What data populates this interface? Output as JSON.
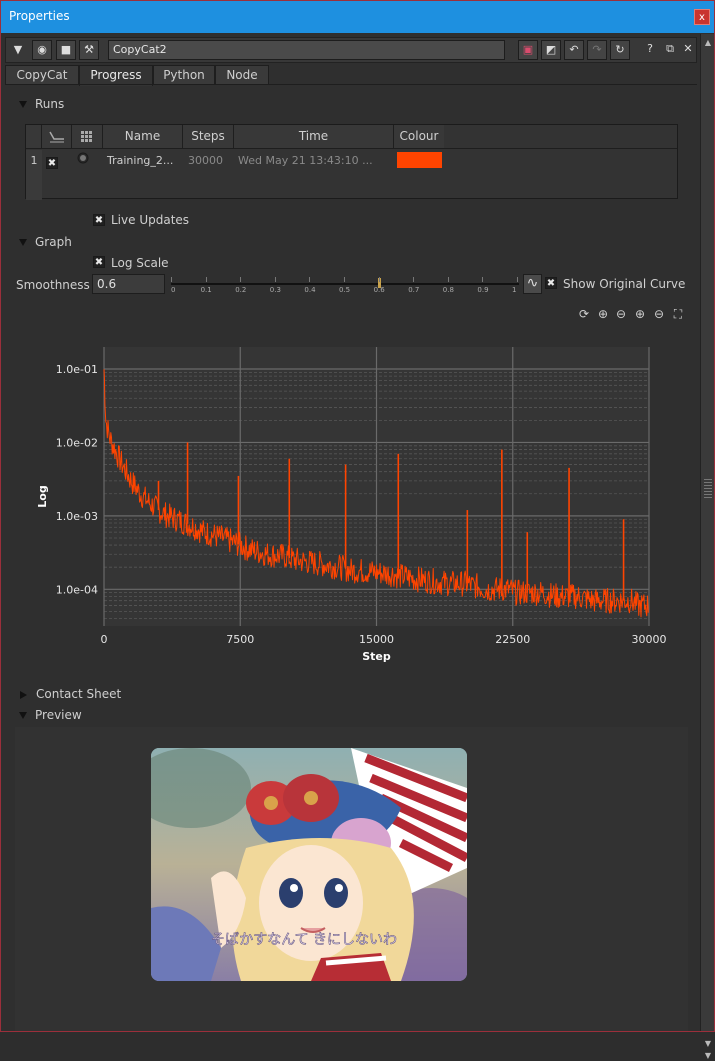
{
  "window": {
    "title": "Properties",
    "close_glyph": "x"
  },
  "toolbar": {
    "node_name": "CopyCat2",
    "icons": [
      "collapse-icon",
      "node-icon",
      "camera-icon",
      "wrench-icon",
      "color-swatch-icon",
      "matte-icon",
      "undo-icon",
      "redo-icon",
      "revert-icon",
      "help-icon",
      "float-icon",
      "close-icon"
    ],
    "help_glyph": "?",
    "float_glyph": "⧉",
    "close_glyph": "✕"
  },
  "tabs": [
    {
      "label": "CopyCat"
    },
    {
      "label": "Progress"
    },
    {
      "label": "Python"
    },
    {
      "label": "Node"
    }
  ],
  "runs": {
    "header": "Runs",
    "columns": [
      "Name",
      "Steps",
      "Time",
      "Colour"
    ],
    "rows": [
      {
        "index": "1",
        "visible": "✖",
        "name": "Training_2...",
        "steps": "30000",
        "time": "Wed May 21 13:43:10 ...",
        "colour": "#ff4400"
      }
    ]
  },
  "live_updates": {
    "label": "Live Updates",
    "checked": "✖"
  },
  "graph": {
    "header": "Graph",
    "log_scale": {
      "label": "Log Scale",
      "checked": "✖"
    },
    "smoothness": {
      "label": "Smoothness",
      "value": "0.6",
      "fraction": 0.6,
      "ticks": [
        "0",
        "0.1",
        "0.2",
        "0.3",
        "0.4",
        "0.5",
        "0.6",
        "0.7",
        "0.8",
        "0.9",
        "1"
      ]
    },
    "show_original": {
      "label": "Show Original Curve",
      "checked": "✖"
    },
    "curve_glyph": "∿"
  },
  "chart_data": {
    "type": "line",
    "title": "",
    "xlabel": "Step",
    "ylabel": "Log",
    "xlim": [
      0,
      30000
    ],
    "ylim_log10": [
      -4.5,
      -0.7
    ],
    "x_ticks": [
      "0",
      "7500",
      "15000",
      "22500",
      "30000"
    ],
    "y_ticks": [
      "1.0e-01",
      "1.0e-02",
      "1.0e-03",
      "1.0e-04"
    ],
    "y_scale": "log",
    "grid": true,
    "series": [
      {
        "color": "#ff4400",
        "x": [
          0,
          100,
          300,
          600,
          1000,
          1500,
          2000,
          2500,
          3000,
          3500,
          4000,
          4500,
          5000,
          5500,
          6000,
          6500,
          7000,
          7500,
          8000,
          9000,
          10000,
          10300,
          10600,
          11000,
          12000,
          13000,
          13300,
          13600,
          14000,
          15000,
          16000,
          16200,
          16500,
          17000,
          18000,
          19000,
          20000,
          20300,
          20600,
          21000,
          22000,
          22300,
          22600,
          23000,
          24000,
          25000,
          25500,
          26000,
          27000,
          28000,
          29000,
          29400,
          29800,
          30000
        ],
        "y": [
          0.1,
          0.02,
          0.012,
          0.008,
          0.005,
          0.003,
          0.002,
          0.0015,
          0.0012,
          0.001,
          0.0009,
          0.0008,
          0.0007,
          0.0006,
          0.00055,
          0.0005,
          0.00045,
          0.0004,
          0.00035,
          0.0003,
          0.00028,
          0.00026,
          0.00025,
          0.00024,
          0.00022,
          0.0002,
          0.00019,
          0.00018,
          0.00018,
          0.00017,
          0.00016,
          0.00015,
          0.00015,
          0.00014,
          0.00013,
          0.00012,
          0.00012,
          0.00011,
          0.00011,
          0.0001,
          0.0001,
          0.0001,
          9e-05,
          9e-05,
          9e-05,
          8e-05,
          8e-05,
          8e-05,
          7e-05,
          7e-05,
          7e-05,
          6e-05,
          6e-05,
          6e-05
        ]
      }
    ],
    "spikes": [
      {
        "x": 3000,
        "y": 0.003
      },
      {
        "x": 4600,
        "y": 0.01
      },
      {
        "x": 7400,
        "y": 0.0035
      },
      {
        "x": 10200,
        "y": 0.006
      },
      {
        "x": 13300,
        "y": 0.005
      },
      {
        "x": 16200,
        "y": 0.007
      },
      {
        "x": 20000,
        "y": 0.0012
      },
      {
        "x": 21900,
        "y": 0.008
      },
      {
        "x": 23300,
        "y": 0.0006
      },
      {
        "x": 25600,
        "y": 0.0045
      },
      {
        "x": 28600,
        "y": 0.0009
      }
    ]
  },
  "contact_sheet": {
    "header": "Contact Sheet"
  },
  "preview": {
    "header": "Preview",
    "caption": "そばかすなんて きにしないわ"
  }
}
